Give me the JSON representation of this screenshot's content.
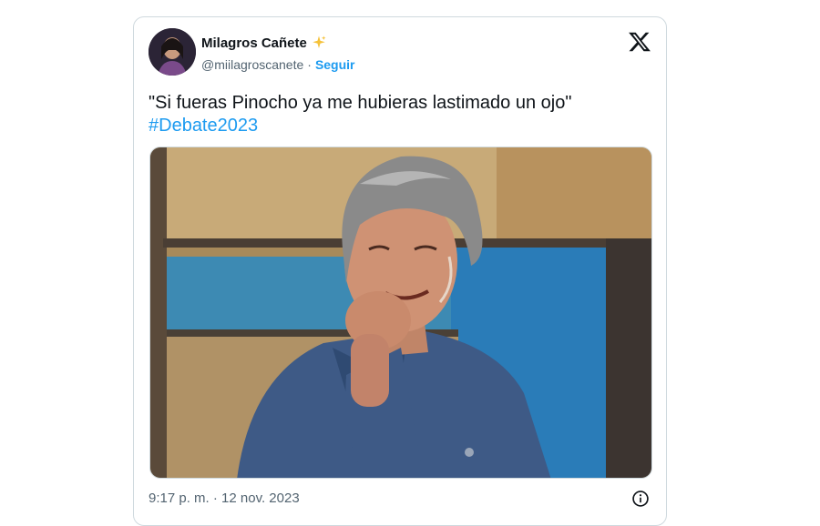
{
  "tweet": {
    "author_name": "Milagros Cañete",
    "author_emoji_icon": "sparkle-icon",
    "handle": "@miilagroscanete",
    "separator": "·",
    "follow_label": "Seguir",
    "text": "\"Si fueras Pinocho ya me hubieras lastimado un ojo\"",
    "hashtag": "#Debate2023",
    "timestamp": "9:17 p. m. · 12 nov. 2023",
    "platform_icon": "x-logo-icon",
    "info_icon": "info-icon"
  },
  "colors": {
    "link": "#1d9bf0",
    "text_primary": "#0f1419",
    "text_secondary": "#536471",
    "border": "#cfd9de",
    "sparkle": "#f5c23a"
  }
}
